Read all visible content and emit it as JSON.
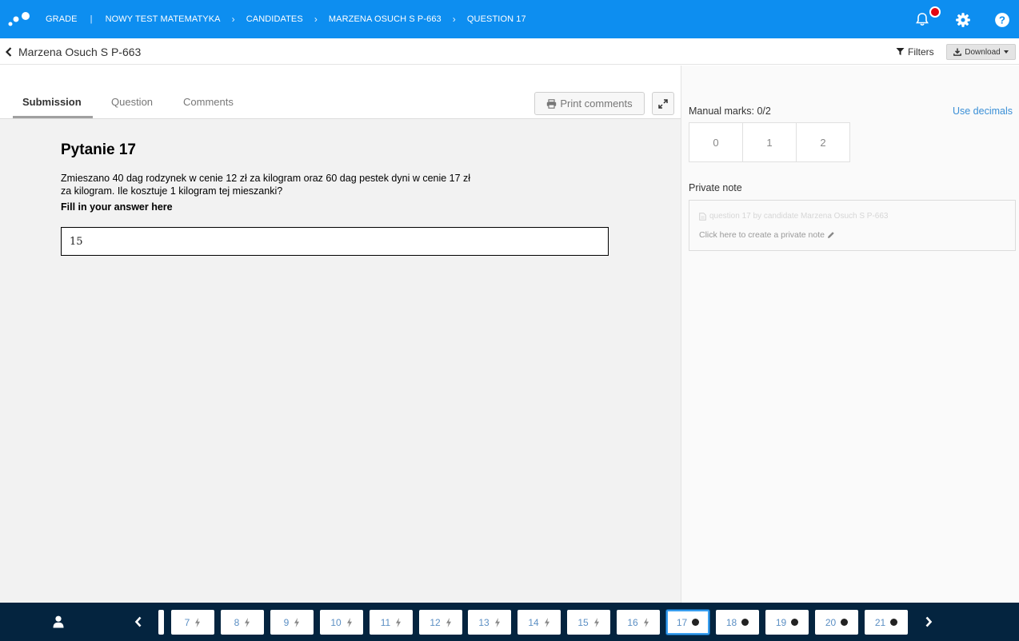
{
  "app": {
    "brand_colors": {
      "primary": "#0d8ef0",
      "footer": "#04243f",
      "alert": "#e30613",
      "link": "#3a8fd6"
    },
    "breadcrumbs": [
      "GRADE",
      "NOWY TEST MATEMATYKA",
      "CANDIDATES",
      "MARZENA OSUCH S P-663",
      "QUESTION 17"
    ],
    "icons": {
      "logo": "dots-logo",
      "notifications": "bell-icon",
      "settings": "gear-icon",
      "help": "question-icon"
    }
  },
  "subheader": {
    "back_label": "Marzena Osuch S P-663",
    "filters_label": "Filters",
    "download_label": "Download"
  },
  "tabs": [
    {
      "label": "Submission",
      "active": true
    },
    {
      "label": "Question",
      "active": false
    },
    {
      "label": "Comments",
      "active": false
    }
  ],
  "toolbar": {
    "print_label": "Print comments"
  },
  "question": {
    "title": "Pytanie 17",
    "text": "Zmieszano 40 dag rodzynek w cenie 12 zł za kilogram oraz 60 dag pestek dyni w cenie 17 zł za kilogram. Ile kosztuje 1 kilogram tej mieszanki?",
    "instruction": "Fill in your answer here",
    "answer": "15"
  },
  "marking": {
    "manual_marks_label": "Manual marks: 0/2",
    "use_decimals_label": "Use decimals",
    "options": [
      "0",
      "1",
      "2"
    ]
  },
  "private_note": {
    "label": "Private note",
    "title": "question 17 by candidate Marzena Osuch S P-663",
    "cta": "Click here to create a private note"
  },
  "navigator": {
    "questions": [
      {
        "number": "7",
        "status": "bolt"
      },
      {
        "number": "8",
        "status": "bolt"
      },
      {
        "number": "9",
        "status": "bolt"
      },
      {
        "number": "10",
        "status": "bolt"
      },
      {
        "number": "11",
        "status": "bolt"
      },
      {
        "number": "12",
        "status": "bolt"
      },
      {
        "number": "13",
        "status": "bolt"
      },
      {
        "number": "14",
        "status": "bolt"
      },
      {
        "number": "15",
        "status": "bolt"
      },
      {
        "number": "16",
        "status": "bolt"
      },
      {
        "number": "17",
        "status": "dot",
        "current": true
      },
      {
        "number": "18",
        "status": "dot"
      },
      {
        "number": "19",
        "status": "dot"
      },
      {
        "number": "20",
        "status": "dot"
      },
      {
        "number": "21",
        "status": "dot"
      }
    ]
  }
}
